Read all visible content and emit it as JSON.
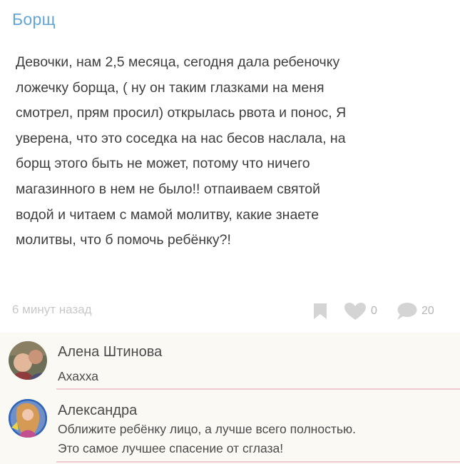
{
  "post": {
    "title": "Борщ",
    "body_lines": [
      "Девочки, нам 2,5 месяца, сегодня дала ребеночку",
      "ложечку борща, ( ну он таким глазками на меня",
      "смотрел, прям просил) открылась рвота и понос, Я",
      "уверена, что это соседка на нас бесов наслала, на",
      "борщ этого быть не может, потому что ничего",
      "магазинного в нем не было!! отпаиваем святой",
      "водой и читаем с мамой молитву, какие знаете",
      "молитвы, что б помочь ребёнку?!"
    ],
    "time": "6 минут назад",
    "likes": "0",
    "comments": "20",
    "icons": {
      "bookmark": "bookmark-icon",
      "like": "heart-icon",
      "comment": "speech-bubble-icon"
    },
    "colors": {
      "title": "#63a6d6",
      "icons": "#d6d6d6"
    }
  },
  "comments": [
    {
      "author": "Алена Штинова",
      "text_lines": [
        "Ахахха"
      ]
    },
    {
      "author": "Александра",
      "text_lines": [
        "Оближите ребёнку лицо, а лучше всего полностью.",
        "Это самое лучшее спасение от сглаза!"
      ]
    }
  ]
}
